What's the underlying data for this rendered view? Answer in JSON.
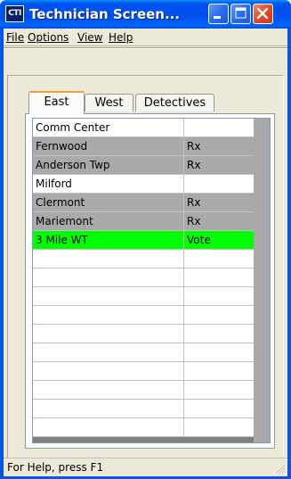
{
  "window": {
    "app_icon_text": "CTI",
    "title": "Technician Screen..."
  },
  "menu": {
    "file": "File",
    "options": "Options",
    "view": "View",
    "help": "Help"
  },
  "tabs": [
    {
      "label": "East",
      "active": true
    },
    {
      "label": "West",
      "active": false
    },
    {
      "label": "Detectives",
      "active": false
    }
  ],
  "grid": {
    "rows": [
      {
        "name": "Comm Center",
        "status": "",
        "bg": "#ffffff"
      },
      {
        "name": "Fernwood",
        "status": "Rx",
        "bg": "#a9a9a9"
      },
      {
        "name": "Anderson Twp",
        "status": "Rx",
        "bg": "#a9a9a9"
      },
      {
        "name": "Milford",
        "status": "",
        "bg": "#ffffff"
      },
      {
        "name": "Clermont",
        "status": "Rx",
        "bg": "#a9a9a9"
      },
      {
        "name": "Mariemont",
        "status": "Rx",
        "bg": "#a9a9a9"
      },
      {
        "name": "3 Mile WT",
        "status": "Vote",
        "bg": "#00ff00"
      },
      {
        "name": "",
        "status": "",
        "bg": "#ffffff"
      },
      {
        "name": "",
        "status": "",
        "bg": "#ffffff"
      },
      {
        "name": "",
        "status": "",
        "bg": "#ffffff"
      },
      {
        "name": "",
        "status": "",
        "bg": "#ffffff"
      },
      {
        "name": "",
        "status": "",
        "bg": "#ffffff"
      },
      {
        "name": "",
        "status": "",
        "bg": "#ffffff"
      },
      {
        "name": "",
        "status": "",
        "bg": "#ffffff"
      },
      {
        "name": "",
        "status": "",
        "bg": "#ffffff"
      },
      {
        "name": "",
        "status": "",
        "bg": "#ffffff"
      },
      {
        "name": "",
        "status": "",
        "bg": "#ffffff"
      }
    ]
  },
  "status_bar": {
    "text": "For Help, press F1"
  },
  "colors": {
    "titlebar": "#0050ee",
    "face": "#ece9d8",
    "rx_row": "#a9a9a9",
    "vote_row": "#00ff00"
  }
}
